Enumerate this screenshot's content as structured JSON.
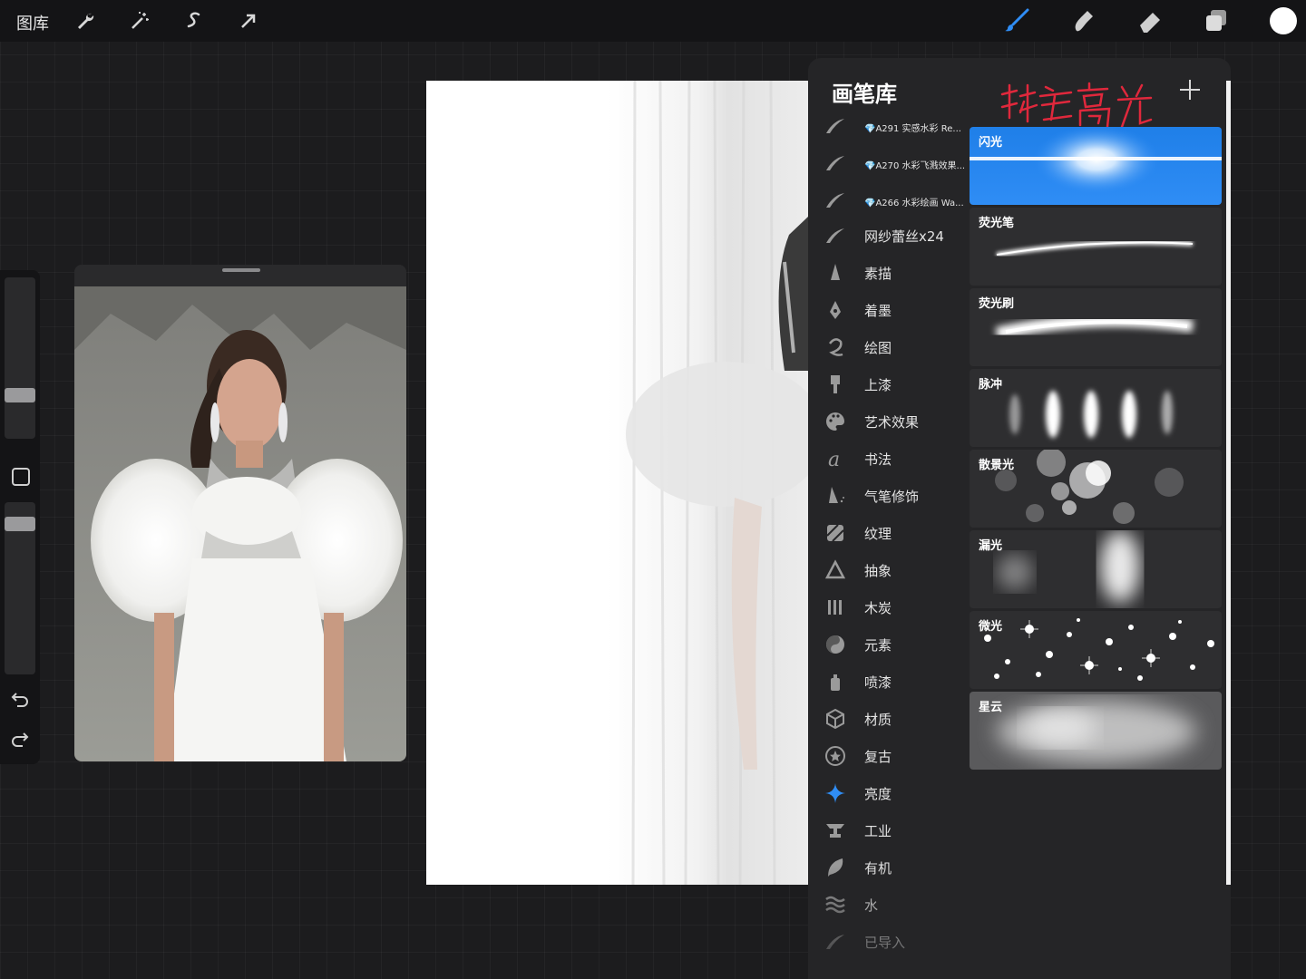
{
  "toolbar": {
    "gallery_label": "图库",
    "left_tools": [
      "wrench-icon",
      "magic-wand-icon",
      "selection-icon",
      "transform-arrow-icon"
    ],
    "right_tools": [
      "brush-icon",
      "smudge-icon",
      "eraser-icon",
      "layers-icon"
    ],
    "accent_color": "#2f8df5",
    "current_color": "#ffffff"
  },
  "sidebar": {
    "icons": [
      "square-icon",
      "undo-icon",
      "redo-icon"
    ]
  },
  "reference": {
    "image": "runway-model-white-feather-dress"
  },
  "brush_library": {
    "title": "画笔库",
    "annotation": "珠宝高光",
    "categories": [
      {
        "label": "A291 实感水彩 Re...",
        "icon": "brush-stroke-icon",
        "imported": true
      },
      {
        "label": "A270 水彩飞溅效果...",
        "icon": "brush-stroke-icon",
        "imported": true
      },
      {
        "label": "A266 水彩绘画 Wa...",
        "icon": "brush-stroke-icon",
        "imported": true
      },
      {
        "label": "网纱蕾丝x24",
        "icon": "brush-stroke-icon"
      },
      {
        "label": "素描",
        "icon": "pencil-icon"
      },
      {
        "label": "着墨",
        "icon": "pen-nib-icon"
      },
      {
        "label": "绘图",
        "icon": "swirl-icon"
      },
      {
        "label": "上漆",
        "icon": "paint-brush-icon"
      },
      {
        "label": "艺术效果",
        "icon": "palette-icon"
      },
      {
        "label": "书法",
        "icon": "calligraphy-icon"
      },
      {
        "label": "气笔修饰",
        "icon": "airbrush-icon"
      },
      {
        "label": "纹理",
        "icon": "texture-icon"
      },
      {
        "label": "抽象",
        "icon": "triangle-icon"
      },
      {
        "label": "木炭",
        "icon": "charcoal-icon"
      },
      {
        "label": "元素",
        "icon": "yin-yang-icon"
      },
      {
        "label": "喷漆",
        "icon": "spray-can-icon"
      },
      {
        "label": "材质",
        "icon": "cube-icon"
      },
      {
        "label": "复古",
        "icon": "star-badge-icon"
      },
      {
        "label": "亮度",
        "icon": "sparkle-icon",
        "selected": true
      },
      {
        "label": "工业",
        "icon": "anvil-icon"
      },
      {
        "label": "有机",
        "icon": "leaf-icon"
      },
      {
        "label": "水",
        "icon": "waves-icon"
      },
      {
        "label": "已导入",
        "icon": "brush-stroke-icon"
      }
    ],
    "brushes": [
      {
        "name": "闪光",
        "preview": "flare",
        "selected": true
      },
      {
        "name": "荧光笔",
        "preview": "glow-stroke"
      },
      {
        "name": "荧光刷",
        "preview": "glow-brush"
      },
      {
        "name": "脉冲",
        "preview": "pulse"
      },
      {
        "name": "散景光",
        "preview": "bokeh"
      },
      {
        "name": "漏光",
        "preview": "light-leak"
      },
      {
        "name": "微光",
        "preview": "sparkles"
      },
      {
        "name": "星云",
        "preview": "nebula"
      }
    ]
  }
}
